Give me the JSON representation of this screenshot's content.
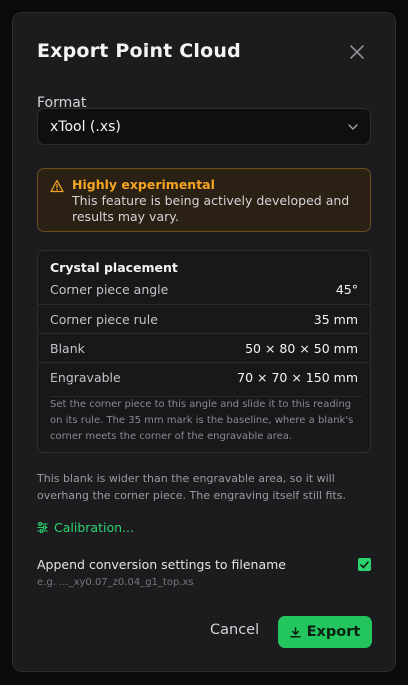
{
  "dialog": {
    "title": "Export Point Cloud"
  },
  "format": {
    "label": "Format",
    "selected": "xTool (.xs)"
  },
  "warning": {
    "title": "Highly experimental",
    "text": "This feature is being actively developed and results may vary."
  },
  "crystal": {
    "title": "Crystal placement",
    "rows": [
      {
        "label": "Corner piece angle",
        "value": "45°"
      },
      {
        "label": "Corner piece rule",
        "value": "35 mm"
      },
      {
        "label": "Blank",
        "value": "50 × 80 × 50 mm"
      },
      {
        "label": "Engravable",
        "value": "70 × 70 × 150 mm"
      }
    ],
    "note": "Set the corner piece to this angle and slide it to this reading on its rule. The 35 mm mark is the baseline, where a blank's corner meets the corner of the engravable area."
  },
  "overhang_text": "This blank is wider than the engravable area, so it will overhang the corner piece. The engraving itself still fits.",
  "calibration_label": "Calibration...",
  "append": {
    "label": "Append conversion settings to filename",
    "example": "e.g. ..._xy0.07_z0.04_g1_top.xs",
    "checked": true
  },
  "actions": {
    "cancel_label": "Cancel",
    "export_label": "Export"
  },
  "colors": {
    "accent": "#22c55e",
    "warning": "#f5a524"
  },
  "icons": {
    "close": "close-icon",
    "chevron": "chevron-down-icon",
    "warning": "warning-triangle-icon",
    "calibration": "sliders-icon",
    "check": "check-icon",
    "download": "download-icon"
  }
}
